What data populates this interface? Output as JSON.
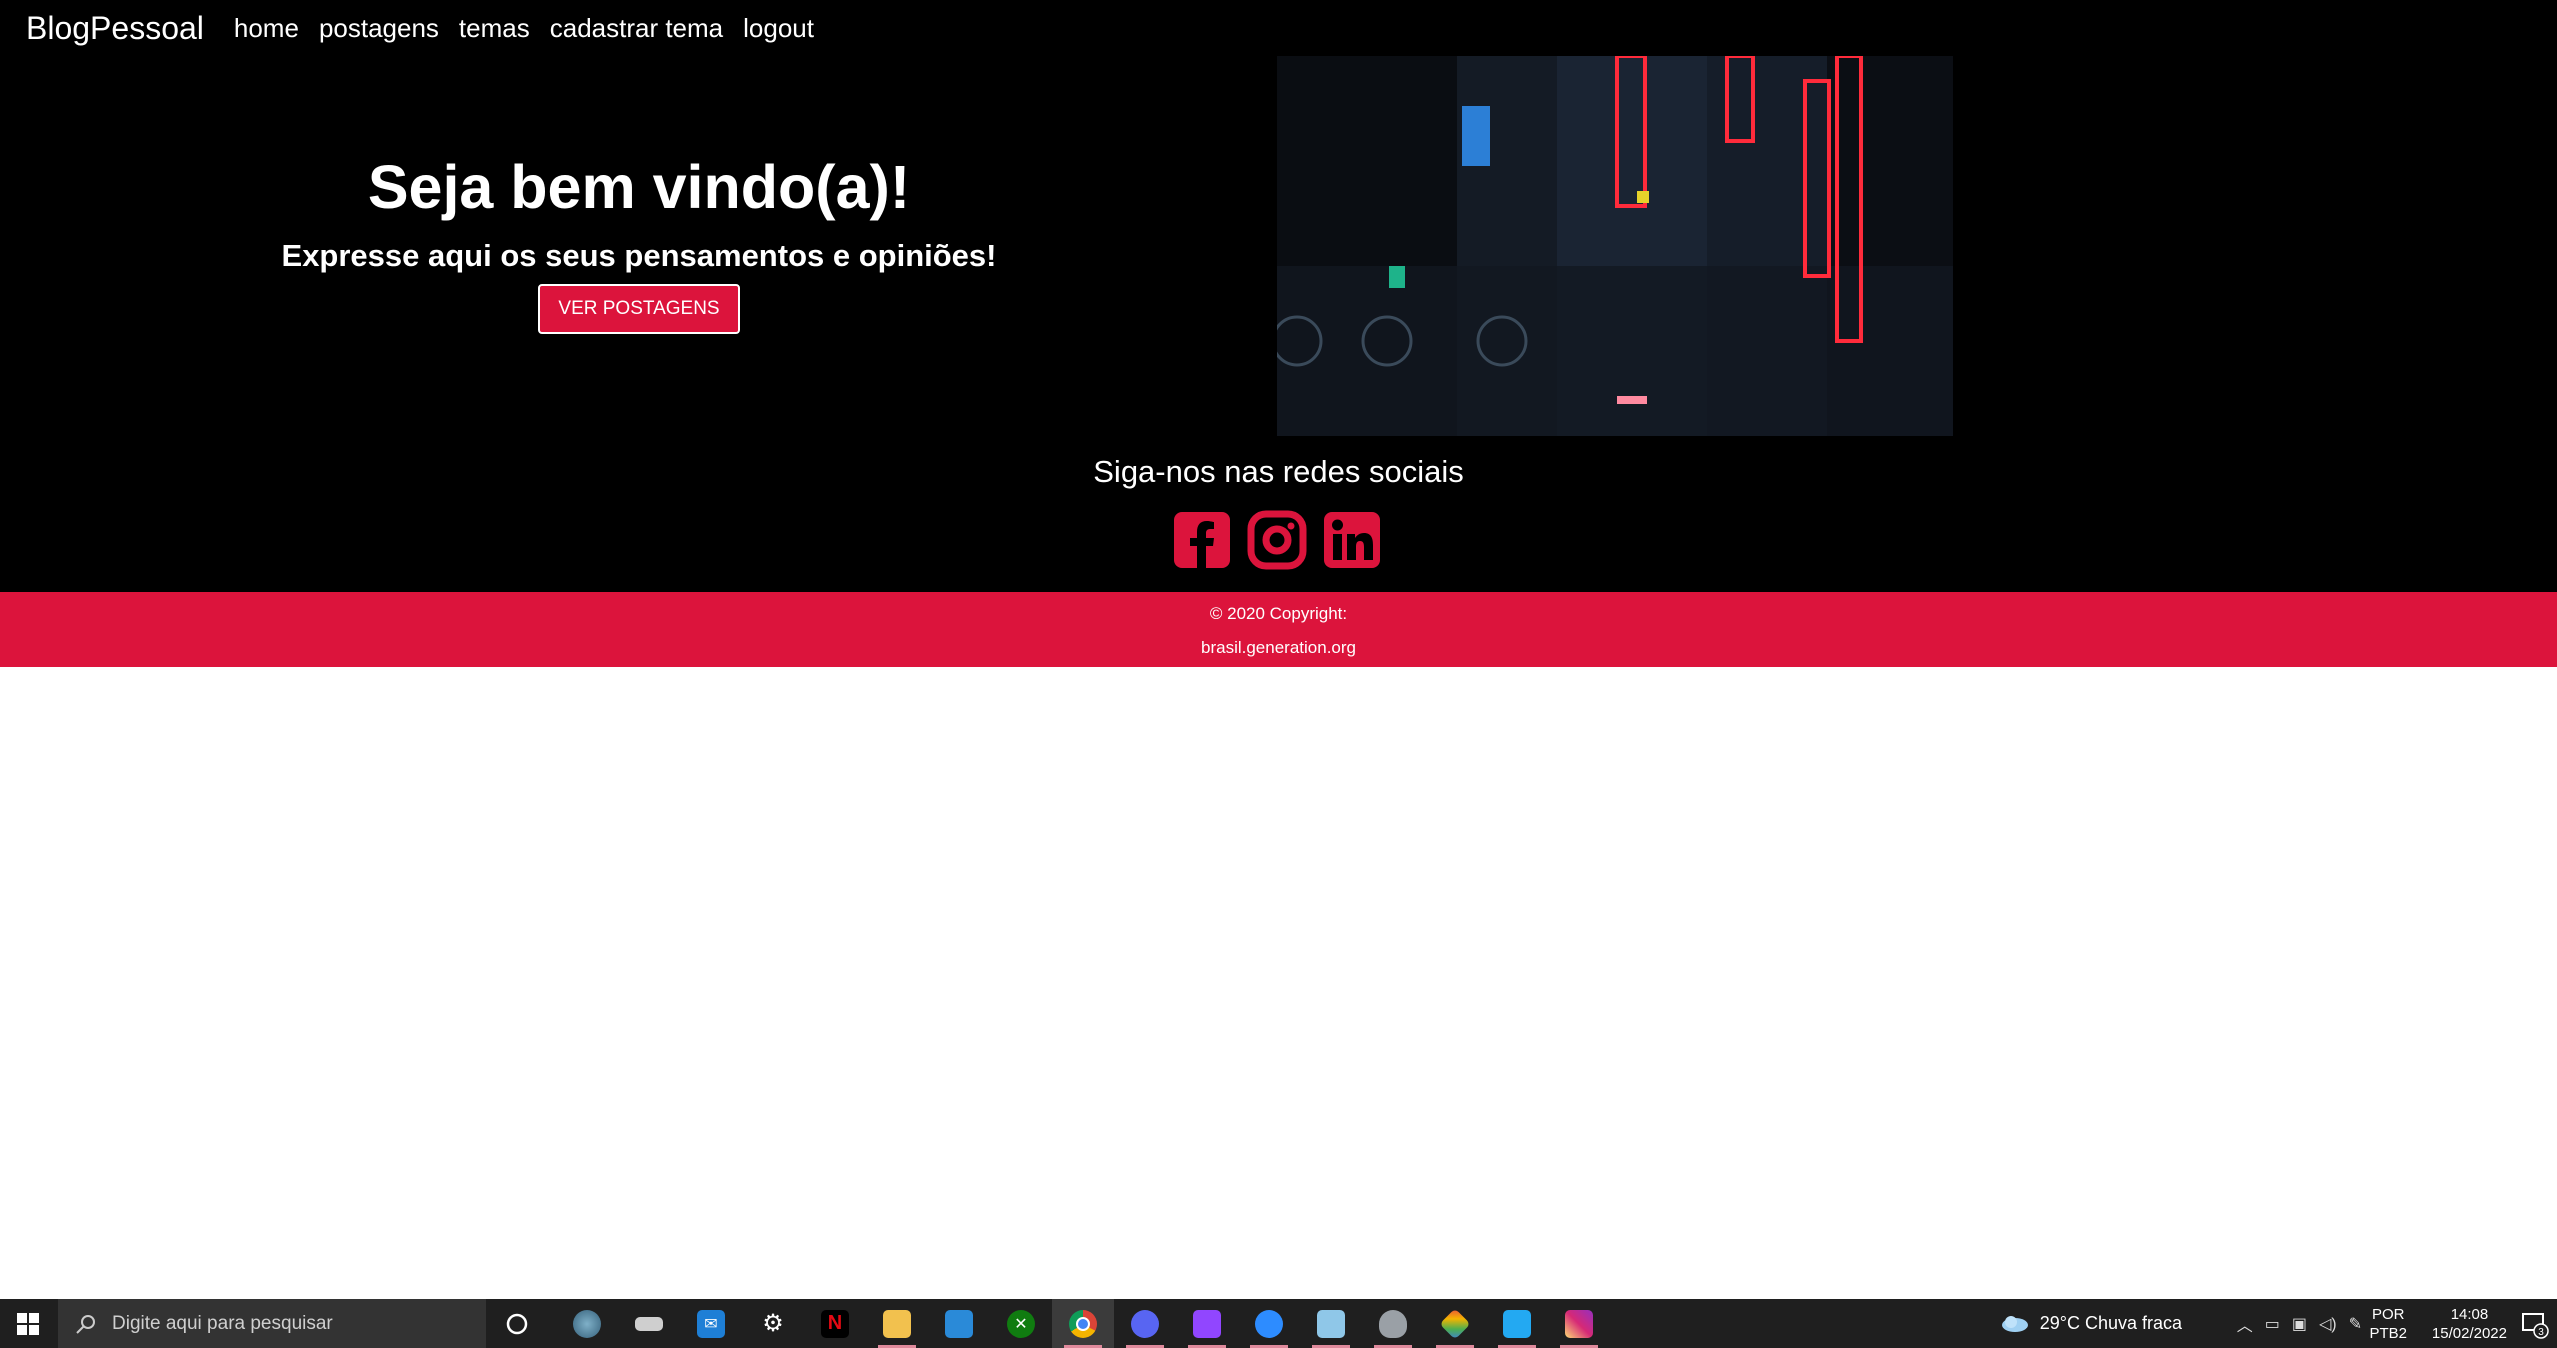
{
  "navbar": {
    "brand": "BlogPessoal",
    "links": [
      "home",
      "postagens",
      "temas",
      "cadastrar tema",
      "logout"
    ]
  },
  "hero": {
    "title": "Seja bem vindo(a)!",
    "subtitle": "Expresse aqui os seus pensamentos e opiniões!",
    "button": "VER POSTAGENS"
  },
  "social": {
    "title": "Siga-nos nas redes sociais",
    "icons": [
      "facebook-icon",
      "instagram-icon",
      "linkedin-icon"
    ],
    "color": "#dc143c"
  },
  "footer": {
    "copyright": "© 2020 Copyright:",
    "site": "brasil.generation.org",
    "color": "#dc143c"
  },
  "taskbar": {
    "search_placeholder": "Digite aqui para pesquisar",
    "apps": [
      "cortana-icon",
      "edge-dev-icon",
      "stack-icon",
      "mail-icon",
      "settings-icon",
      "netflix-icon",
      "file-explorer-icon",
      "store-icon",
      "xbox-icon",
      "chrome-icon",
      "discord-icon",
      "twitch-icon",
      "zoom-icon",
      "notepad-icon",
      "shield-icon",
      "git-icon",
      "vscode-icon",
      "instagram-app-icon"
    ],
    "weather": "29°C  Chuva fraca",
    "lang_line1": "POR",
    "lang_line2": "PTB2",
    "time": "14:08",
    "date": "15/02/2022",
    "notification_count": "3"
  }
}
